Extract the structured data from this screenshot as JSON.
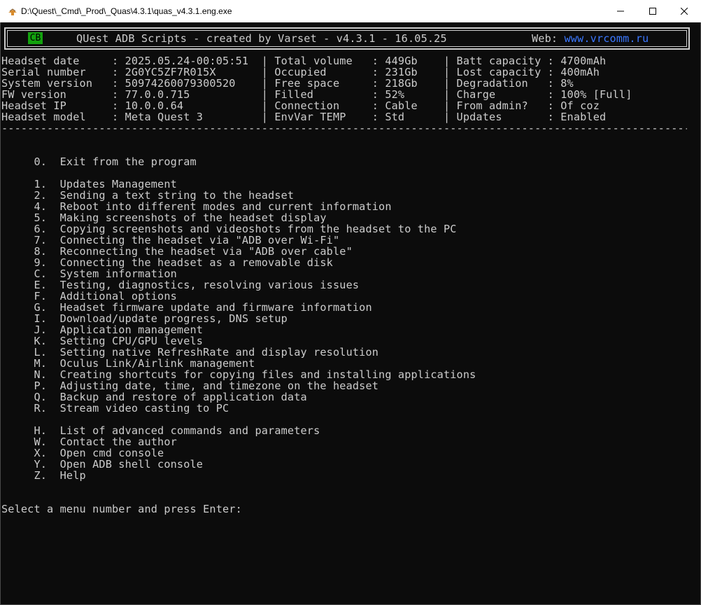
{
  "window": {
    "title": "D:\\Quest\\_Cmd\\_Prod\\_Quas\\4.3.1\\quas_v4.3.1.eng.exe",
    "controls": {
      "minimize": "minimize-icon",
      "maximize": "maximize-icon",
      "close": "close-icon"
    }
  },
  "header": {
    "badge": "CB",
    "title": "QUest ADB Scripts - created by Varset - v4.3.1 - 16.05.25",
    "web_label": "Web: ",
    "web_link": "www.vrcomm.ru",
    "badge_color": "#13a10e",
    "link_color": "#3b78ff"
  },
  "info_lines": [
    "Headset date     : 2025.05.24-00:05:51  | Total volume   : 449Gb    | Batt capacity : 4700mAh",
    "Serial number    : 2G0YC5ZF7R015X       | Occupied       : 231Gb    | Lost capacity : 400mAh",
    "System version   : 50974260079300520    | Free space     : 218Gb    | Degradation   : 8%",
    "FW version       : 77.0.0.715           | Filled         : 52%      | Charge        : 100% [Full]",
    "Headset IP       : 10.0.0.64            | Connection     : Cable    | From admin?   : Of coz",
    "Headset model    : Meta Quest 3         | EnvVar TEMP    : Std      | Updates       : Enabled"
  ],
  "separator": "-----------------------------------------------------------------------------------------------------------------------------",
  "menu_exit": "     0.  Exit from the program",
  "menu_main": [
    "     1.  Updates Management",
    "     2.  Sending a text string to the headset",
    "     4.  Reboot into different modes and current information",
    "     5.  Making screenshots of the headset display",
    "     6.  Copying screenshots and videoshots from the headset to the PC",
    "     7.  Connecting the headset via \"ADB over Wi-Fi\"",
    "     8.  Reconnecting the headset via \"ADB over cable\"",
    "     9.  Connecting the headset as a removable disk",
    "     C.  System information",
    "     E.  Testing, diagnostics, resolving various issues",
    "     F.  Additional options",
    "     G.  Headset firmware update and firmware information",
    "     I.  Download/update progress, DNS setup",
    "     J.  Application management",
    "     K.  Setting CPU/GPU levels",
    "     L.  Setting native RefreshRate and display resolution",
    "     M.  Oculus Link/Airlink management",
    "     N.  Creating shortcuts for copying files and installing applications",
    "     P.  Adjusting date, time, and timezone on the headset",
    "     Q.  Backup and restore of application data",
    "     R.  Stream video casting to PC"
  ],
  "menu_extra": [
    "     H.  List of advanced commands and parameters",
    "     W.  Contact the author",
    "     X.  Open cmd console",
    "     Y.  Open ADB shell console",
    "     Z.  Help"
  ],
  "prompt": "Select a menu number and press Enter:"
}
